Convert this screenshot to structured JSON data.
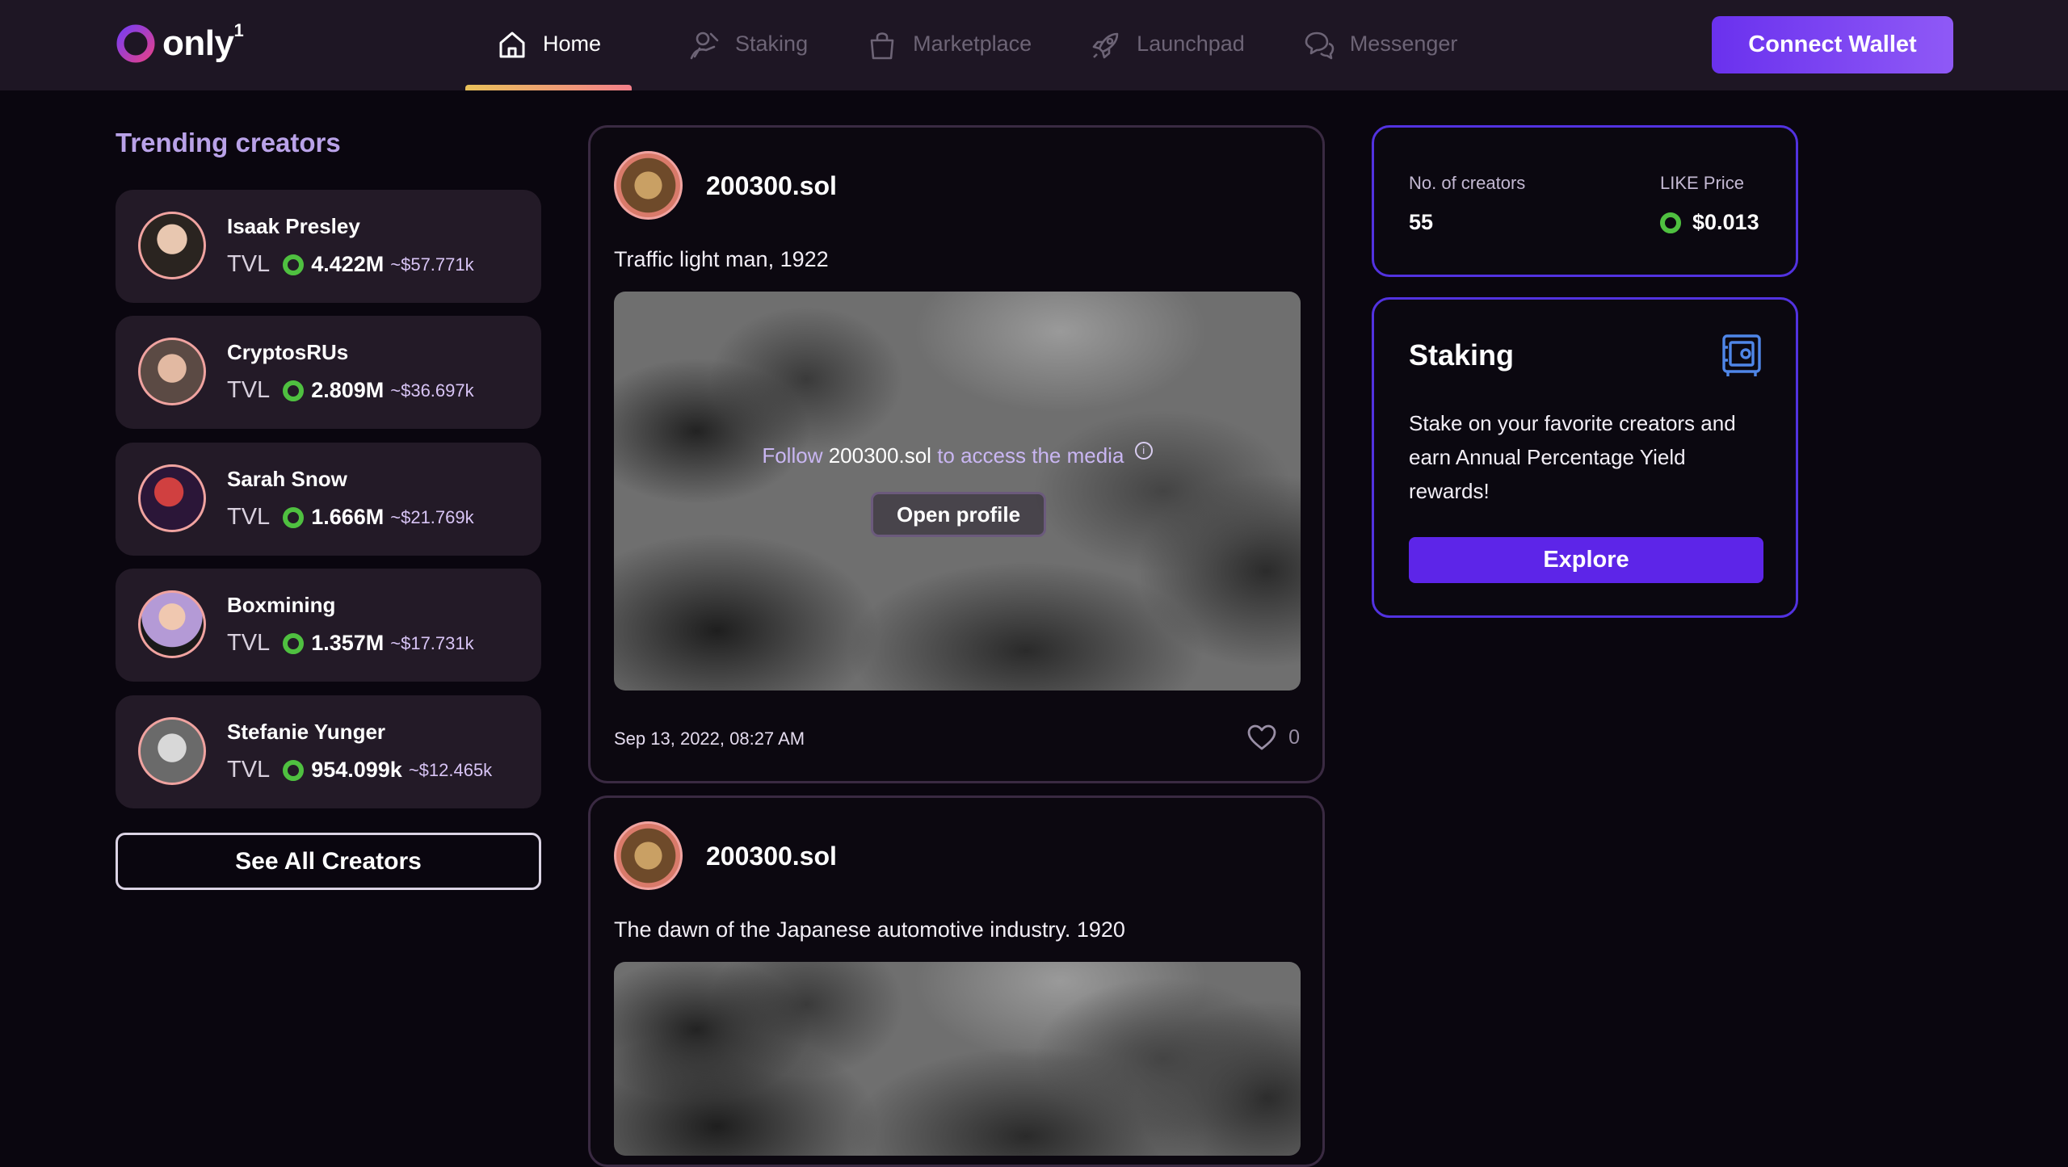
{
  "app": {
    "logo_text": "only",
    "logo_sup": "1"
  },
  "nav": {
    "items": [
      {
        "label": "Home",
        "icon": "home-icon",
        "active": true
      },
      {
        "label": "Staking",
        "icon": "staking-icon",
        "active": false
      },
      {
        "label": "Marketplace",
        "icon": "shopping-bag-icon",
        "active": false
      },
      {
        "label": "Launchpad",
        "icon": "rocket-icon",
        "active": false
      },
      {
        "label": "Messenger",
        "icon": "chat-bubbles-icon",
        "active": false
      }
    ],
    "connect_wallet": "Connect Wallet"
  },
  "trending": {
    "title": "Trending creators",
    "tvl_label": "TVL",
    "creators": [
      {
        "name": "Isaak Presley",
        "tvl": "4.422M",
        "usd": "~$57.771k"
      },
      {
        "name": "CryptosRUs",
        "tvl": "2.809M",
        "usd": "~$36.697k"
      },
      {
        "name": "Sarah Snow",
        "tvl": "1.666M",
        "usd": "~$21.769k"
      },
      {
        "name": "Boxmining",
        "tvl": "1.357M",
        "usd": "~$17.731k"
      },
      {
        "name": "Stefanie Yunger",
        "tvl": "954.099k",
        "usd": "~$12.465k"
      }
    ],
    "see_all": "See All Creators"
  },
  "feed": {
    "posts": [
      {
        "author": "200300.sol",
        "caption": "Traffic light man, 1922",
        "media_prefix": "Follow",
        "media_who": "200300.sol",
        "media_suffix": "to access the media",
        "open_profile": "Open profile",
        "date": "Sep 13, 2022, 08:27 AM",
        "likes": "0"
      },
      {
        "author": "200300.sol",
        "caption": "The dawn of the Japanese automotive industry. 1920"
      }
    ]
  },
  "stats": {
    "creators_label": "No. of creators",
    "creators_value": "55",
    "price_label": "LIKE Price",
    "price_value": "$0.013"
  },
  "staking": {
    "title": "Staking",
    "description": "Stake on your favorite creators and earn Annual Percentage Yield rewards!",
    "explore": "Explore"
  },
  "colors": {
    "accent": "#5d25e8",
    "coin_green": "#4fc040",
    "card_border": "#5232e0",
    "nav_active_gradient_start": "#e9c15a",
    "nav_active_gradient_end": "#f37f8a"
  }
}
